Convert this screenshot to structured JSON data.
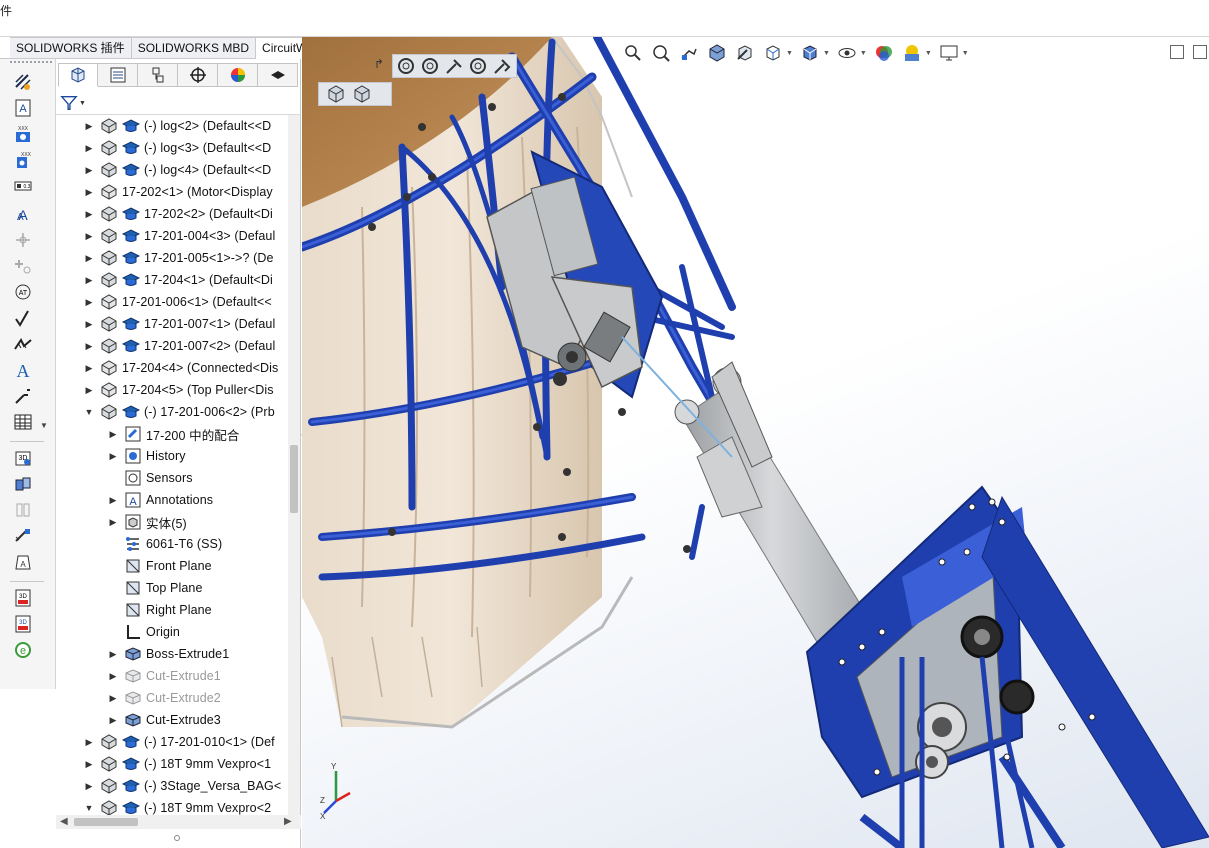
{
  "top_strip": {
    "clip_text": "件"
  },
  "command_tabs": [
    {
      "label": "SOLIDWORKS 插件",
      "active": false
    },
    {
      "label": "SOLIDWORKS MBD",
      "active": false
    },
    {
      "label": "CircuitWorks",
      "active": true
    }
  ],
  "left_toolbar": {
    "icons": [
      "smart-dimension-icon",
      "note-icon",
      "balloon-icon",
      "auto-balloon-icon",
      "bill-of-materials-icon",
      "weld-symbol-icon",
      "datum-target-icon",
      "add-datum-icon",
      "datum-feature-icon",
      "surface-finish-icon",
      "weld-bead-icon",
      "text-icon",
      "leader-icon",
      "table-icon",
      "3d-view-icon",
      "explode-view-icon",
      "section-view-icon",
      "measure-icon",
      "mass-properties-icon",
      "publish-3dpdf-icon",
      "export-3dpdf-icon",
      "edrawings-icon"
    ]
  },
  "feature_manager": {
    "tabs": [
      "feature-tree-icon",
      "property-manager-icon",
      "configuration-manager-icon",
      "dimxpert-icon",
      "display-manager-icon",
      "cam-icon"
    ],
    "tree": [
      {
        "label": "(-) log<2> (Default<<D",
        "level": 0,
        "arrow": "▶",
        "type": "part"
      },
      {
        "label": "(-) log<3> (Default<<D",
        "level": 0,
        "arrow": "▶",
        "type": "part"
      },
      {
        "label": "(-) log<4> (Default<<D",
        "level": 0,
        "arrow": "▶",
        "type": "part"
      },
      {
        "label": "17-202<1> (Motor<Display",
        "level": 0,
        "arrow": "▶",
        "type": "assembly"
      },
      {
        "label": "17-202<2> (Default<Di",
        "level": 0,
        "arrow": "▶",
        "type": "part"
      },
      {
        "label": "17-201-004<3> (Defaul",
        "level": 0,
        "arrow": "▶",
        "type": "part"
      },
      {
        "label": "17-201-005<1>->? (De",
        "level": 0,
        "arrow": "▶",
        "type": "part"
      },
      {
        "label": "17-204<1> (Default<Di",
        "level": 0,
        "arrow": "▶",
        "type": "part"
      },
      {
        "label": "17-201-006<1> (Default<<",
        "level": 0,
        "arrow": "▶",
        "type": "assembly"
      },
      {
        "label": "17-201-007<1> (Defaul",
        "level": 0,
        "arrow": "▶",
        "type": "part"
      },
      {
        "label": "17-201-007<2> (Defaul",
        "level": 0,
        "arrow": "▶",
        "type": "part"
      },
      {
        "label": "17-204<4> (Connected<Dis",
        "level": 0,
        "arrow": "▶",
        "type": "assembly"
      },
      {
        "label": "17-204<5> (Top Puller<Dis",
        "level": 0,
        "arrow": "▶",
        "type": "assembly"
      },
      {
        "label": "(-) 17-201-006<2> (Prb",
        "level": 0,
        "arrow": "▼",
        "type": "part"
      },
      {
        "label": "17-200 中的配合",
        "level": 1,
        "arrow": "▶",
        "type": "mates"
      },
      {
        "label": "History",
        "level": 1,
        "arrow": "▶",
        "type": "history"
      },
      {
        "label": "Sensors",
        "level": 1,
        "arrow": "",
        "type": "sensors"
      },
      {
        "label": "Annotations",
        "level": 1,
        "arrow": "▶",
        "type": "annotations"
      },
      {
        "label": "实体(5)",
        "level": 1,
        "arrow": "▶",
        "type": "bodies"
      },
      {
        "label": "6061-T6 (SS)",
        "level": 1,
        "arrow": "",
        "type": "material"
      },
      {
        "label": "Front Plane",
        "level": 1,
        "arrow": "",
        "type": "plane"
      },
      {
        "label": "Top Plane",
        "level": 1,
        "arrow": "",
        "type": "plane"
      },
      {
        "label": "Right Plane",
        "level": 1,
        "arrow": "",
        "type": "plane"
      },
      {
        "label": "Origin",
        "level": 1,
        "arrow": "",
        "type": "origin"
      },
      {
        "label": "Boss-Extrude1",
        "level": 1,
        "arrow": "▶",
        "type": "feature"
      },
      {
        "label": "Cut-Extrude1",
        "level": 1,
        "arrow": "▶",
        "type": "feature-suppressed"
      },
      {
        "label": "Cut-Extrude2",
        "level": 1,
        "arrow": "▶",
        "type": "feature-suppressed"
      },
      {
        "label": "Cut-Extrude3",
        "level": 1,
        "arrow": "▶",
        "type": "feature"
      },
      {
        "label": "(-) 17-201-010<1> (Def",
        "level": 0,
        "arrow": "▶",
        "type": "part"
      },
      {
        "label": "(-) 18T 9mm Vexpro<1",
        "level": 0,
        "arrow": "▶",
        "type": "part"
      },
      {
        "label": "(-) 3Stage_Versa_BAG<",
        "level": 0,
        "arrow": "▶",
        "type": "part"
      },
      {
        "label": "(-) 18T 9mm Vexpro<2",
        "level": 0,
        "arrow": "▼",
        "type": "part"
      }
    ]
  },
  "heads_up_toolbar": [
    "zoom-to-fit-icon",
    "zoom-to-area-icon",
    "previous-view-icon",
    "section-view-icon",
    "dynamic-annotation-icon",
    "view-orientation-icon",
    "display-style-icon",
    "hide-show-items-icon",
    "edit-appearance-icon",
    "apply-scene-icon",
    "view-settings-icon"
  ],
  "view_toolbar_1": [
    "rotate-icon",
    "rotate-icon-2",
    "pan-icon",
    "roll-icon",
    "zoom-icon"
  ],
  "view_toolbar_2": [
    "isometric-view-icon",
    "trimetric-view-icon"
  ],
  "colors": {
    "frame_blue": "#1f3fae",
    "frame_blue_light": "#3a5fd6",
    "wood": "#e8d8c2",
    "grey_part": "#b9bcbf",
    "tab_bg": "#eef0f3"
  }
}
